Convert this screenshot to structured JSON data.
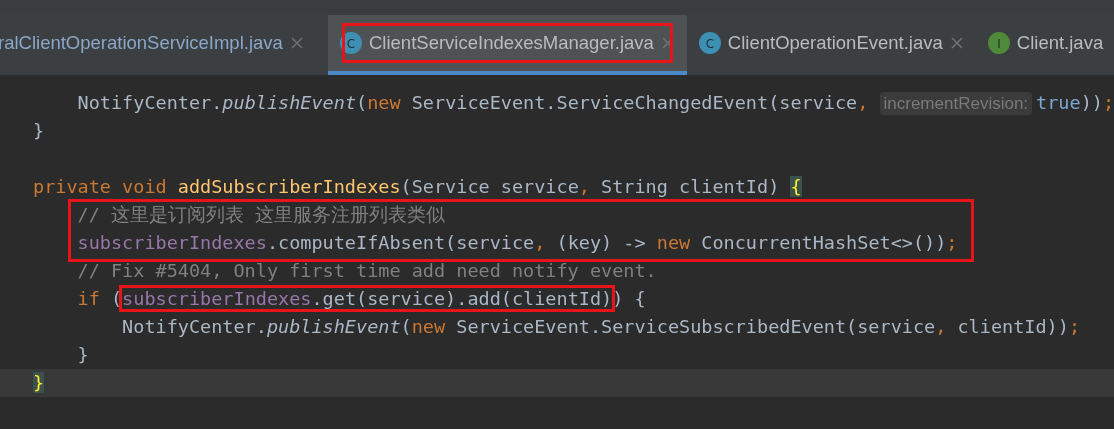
{
  "tabs": [
    {
      "label": "ralClientOperationServiceImpl.java",
      "selected": false,
      "closable": true,
      "boxed": false
    },
    {
      "label": "ClientServiceIndexesManager.java",
      "icon": {
        "kind": "class",
        "letter": "C"
      },
      "selected": true,
      "closable": true,
      "boxed": true
    },
    {
      "label": "ClientOperationEvent.java",
      "icon": {
        "kind": "class",
        "letter": "C"
      },
      "selected": false,
      "closable": true,
      "boxed": false
    },
    {
      "label": "Client.java",
      "icon": {
        "kind": "interface",
        "letter": "I"
      },
      "selected": false,
      "closable": false,
      "boxed": false
    }
  ],
  "code_lines": [
    {
      "boxed": false,
      "current": false,
      "tokens": [
        {
          "kind": "plain",
          "text": "    NotifyCenter."
        },
        {
          "kind": "static",
          "text": "publishEvent"
        },
        {
          "kind": "plain",
          "text": "("
        },
        {
          "kind": "keyword",
          "text": "new"
        },
        {
          "kind": "plain",
          "text": " ServiceEvent.ServiceChangedEvent(service"
        },
        {
          "kind": "punct",
          "text": ", "
        },
        {
          "kind": "hint",
          "text": "incrementRevision:"
        },
        {
          "kind": "literal",
          "text": "true"
        },
        {
          "kind": "plain",
          "text": "))"
        },
        {
          "kind": "punct",
          "text": ";"
        }
      ]
    },
    {
      "boxed": false,
      "current": false,
      "blank_after": true,
      "tokens": [
        {
          "kind": "plain",
          "text": "}"
        }
      ]
    },
    {
      "boxed": false,
      "current": false,
      "tokens": [
        {
          "kind": "keyword",
          "text": "private void "
        },
        {
          "kind": "decl",
          "text": "addSubscriberIndexes"
        },
        {
          "kind": "plain",
          "text": "(Service service"
        },
        {
          "kind": "punct",
          "text": ","
        },
        {
          "kind": "plain",
          "text": " String clientId) "
        },
        {
          "kind": "brace",
          "text": "{"
        }
      ]
    },
    {
      "boxed": true,
      "current": false,
      "tokens": [
        {
          "kind": "comment",
          "text": "    // 这里是订阅列表 这里服务注册列表类似"
        }
      ]
    },
    {
      "boxed": true,
      "current": false,
      "tokens": [
        {
          "kind": "field",
          "text": "    subscriberIndexes"
        },
        {
          "kind": "plain",
          "text": ".computeIfAbsent(service"
        },
        {
          "kind": "punct",
          "text": ","
        },
        {
          "kind": "plain",
          "text": " (key) -> "
        },
        {
          "kind": "keyword",
          "text": "new"
        },
        {
          "kind": "plain",
          "text": " ConcurrentHashSet<>())"
        },
        {
          "kind": "punct",
          "text": ";"
        }
      ]
    },
    {
      "boxed": false,
      "current": false,
      "tokens": [
        {
          "kind": "comment",
          "text": "    // Fix #5404, Only first time add need notify event."
        }
      ]
    },
    {
      "boxed": false,
      "current": false,
      "tokens": [
        {
          "kind": "keyword",
          "text": "    if"
        },
        {
          "kind": "plain",
          "text": " ("
        },
        {
          "kind": "field",
          "text": "subscriberIndexes",
          "boxed": true
        },
        {
          "kind": "plain",
          "text": ".get(service).add(clientId)",
          "boxed": true
        },
        {
          "kind": "plain",
          "text": ") {"
        }
      ]
    },
    {
      "boxed": false,
      "current": false,
      "tokens": [
        {
          "kind": "plain",
          "text": "        NotifyCenter."
        },
        {
          "kind": "static",
          "text": "publishEvent"
        },
        {
          "kind": "plain",
          "text": "("
        },
        {
          "kind": "keyword",
          "text": "new"
        },
        {
          "kind": "plain",
          "text": " ServiceEvent.ServiceSubscribedEvent(service"
        },
        {
          "kind": "punct",
          "text": ","
        },
        {
          "kind": "plain",
          "text": " clientId))"
        },
        {
          "kind": "punct",
          "text": ";"
        }
      ]
    },
    {
      "boxed": false,
      "current": false,
      "tokens": [
        {
          "kind": "plain",
          "text": "    }"
        }
      ]
    },
    {
      "boxed": false,
      "current": true,
      "tokens": [
        {
          "kind": "brace",
          "text": "}"
        }
      ]
    }
  ]
}
